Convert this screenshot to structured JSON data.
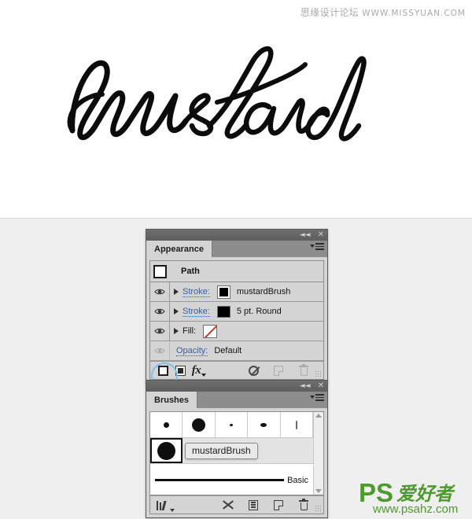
{
  "canvas": {
    "artwork_text": "mustard",
    "artwork_description": "handwritten-script-lettering",
    "watermark_cn": "思缘设计论坛",
    "watermark_url": "WWW.MISSYUAN.COM"
  },
  "appearance_panel": {
    "tab_label": "Appearance",
    "titlebar": {
      "collapse_icon": "collapse-to-icons",
      "close_icon": "close-panel"
    },
    "menu_icon": "panel-menu",
    "object_row": {
      "thumbnail_icon": "path-object-thumbnail",
      "title": "Path"
    },
    "rows": [
      {
        "visibility_icon": "eye-visible",
        "disclosure_icon": "triangle-collapsed",
        "label": "Stroke:",
        "label_is_link": true,
        "swatch": "black-double-border",
        "value": "mustardBrush"
      },
      {
        "visibility_icon": "eye-visible",
        "disclosure_icon": "triangle-collapsed",
        "label": "Stroke:",
        "label_is_link": true,
        "swatch": "black",
        "value": "5 pt. Round"
      },
      {
        "visibility_icon": "eye-visible",
        "disclosure_icon": "triangle-collapsed",
        "label": "Fill:",
        "label_is_link": false,
        "swatch": "none",
        "value": ""
      },
      {
        "visibility_icon": "eye-dimmed",
        "disclosure_icon": "",
        "label": "Opacity:",
        "label_is_link": true,
        "swatch": "",
        "value": "Default"
      }
    ],
    "footer": [
      {
        "icon": "add-new-stroke-icon",
        "label": "Add New Stroke",
        "disabled": false,
        "highlighted": true
      },
      {
        "icon": "add-new-fill-icon",
        "label": "Add New Fill",
        "disabled": false,
        "highlighted": false
      },
      {
        "icon": "fx-effects-icon",
        "label": "Add New Effect",
        "disabled": false,
        "highlighted": false
      },
      {
        "icon": "clear-appearance-icon",
        "label": "Clear Appearance",
        "disabled": false,
        "highlighted": false
      },
      {
        "icon": "duplicate-item-icon",
        "label": "Duplicate Selected Item",
        "disabled": true,
        "highlighted": false
      },
      {
        "icon": "delete-item-icon",
        "label": "Delete Selected Item",
        "disabled": true,
        "highlighted": false
      }
    ],
    "resize_grip_icon": "resize-grip"
  },
  "brushes_panel": {
    "tab_label": "Brushes",
    "titlebar": {
      "collapse_icon": "collapse-to-icons",
      "close_icon": "close-panel"
    },
    "menu_icon": "panel-menu",
    "thumbnails": [
      {
        "icon": "brush-dot-small",
        "selected": false
      },
      {
        "icon": "brush-dot-large",
        "selected": false
      },
      {
        "icon": "brush-speck-tiny",
        "selected": false
      },
      {
        "icon": "brush-oval-dot",
        "selected": false
      },
      {
        "icon": "brush-thin-stroke",
        "selected": false
      }
    ],
    "selected_brush": {
      "icon": "brush-dot-xlarge",
      "selected": true,
      "tooltip": "mustardBrush"
    },
    "basic_brush": {
      "icon": "basic-stroke-line",
      "name": "Basic"
    },
    "scrollbar": {
      "up_icon": "scroll-up-arrow",
      "down_icon": "scroll-down-arrow"
    },
    "footer": [
      {
        "icon": "brush-libraries-menu-icon",
        "label": "Brush Libraries Menu",
        "disabled": false
      },
      {
        "icon": "remove-brush-stroke-icon",
        "label": "Remove Brush Stroke",
        "disabled": false
      },
      {
        "icon": "brush-options-icon",
        "label": "Options of Selected Object",
        "disabled": false
      },
      {
        "icon": "new-brush-icon",
        "label": "New Brush",
        "disabled": false
      },
      {
        "icon": "delete-brush-icon",
        "label": "Delete Brush",
        "disabled": false
      }
    ],
    "resize_grip_icon": "resize-grip"
  },
  "site_logo": {
    "ps_text": "PS",
    "cn_text": "爱好者",
    "url_text": "www.psahz.com",
    "color": "#4e9a2e"
  },
  "colors": {
    "panel_bg": "#d4d4d4",
    "titlebar": "#5e5e5e",
    "tabbar": "#8d8d8d",
    "link_blue": "#2e5fa8",
    "highlight_ring": "#7ec0e8",
    "canvas_bg": "#ffffff",
    "page_bg": "#efefef",
    "ink_black": "#111111"
  }
}
